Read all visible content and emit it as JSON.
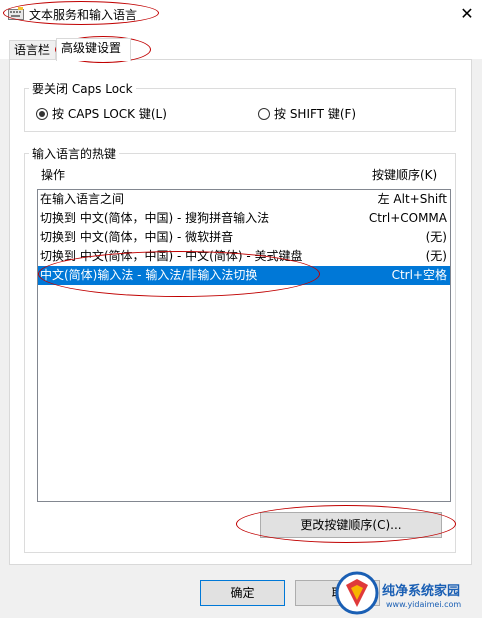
{
  "window": {
    "title": "文本服务和输入语言",
    "close_glyph": "✕"
  },
  "tabs": [
    {
      "label": "语言栏",
      "active": false
    },
    {
      "label": "高级键设置",
      "active": true
    }
  ],
  "caps_lock_group": {
    "label": "要关闭 Caps Lock",
    "options": [
      {
        "label": "按 CAPS LOCK 键(L)",
        "checked": true
      },
      {
        "label": "按 SHIFT 键(F)",
        "checked": false
      }
    ]
  },
  "hotkeys_group": {
    "label": "输入语言的热键",
    "columns": {
      "action": "操作",
      "keys": "按键顺序(K)"
    },
    "rows": [
      {
        "action": "在输入语言之间",
        "keys": "左 Alt+Shift",
        "selected": false
      },
      {
        "action": "切换到 中文(简体，中国) - 搜狗拼音输入法",
        "keys": "Ctrl+COMMA",
        "selected": false
      },
      {
        "action": "切换到 中文(简体，中国) - 微软拼音",
        "keys": "(无)",
        "selected": false
      },
      {
        "action": "切换到 中文(简体，中国) - 中文(简体) - 美式键盘",
        "keys": "(无)",
        "selected": false
      },
      {
        "action": "中文(简体)输入法 - 输入法/非输入法切换",
        "keys": "Ctrl+空格",
        "selected": true
      }
    ],
    "change_button": "更改按键顺序(C)..."
  },
  "footer": {
    "ok_button": "确定",
    "cancel_button": "取"
  },
  "watermark": {
    "title": "纯净系统家园",
    "url": "www.yidaimei.com"
  },
  "colors": {
    "selection": "#0078d7",
    "annotation": "#c00000",
    "watermark": "#1a5fb4"
  }
}
